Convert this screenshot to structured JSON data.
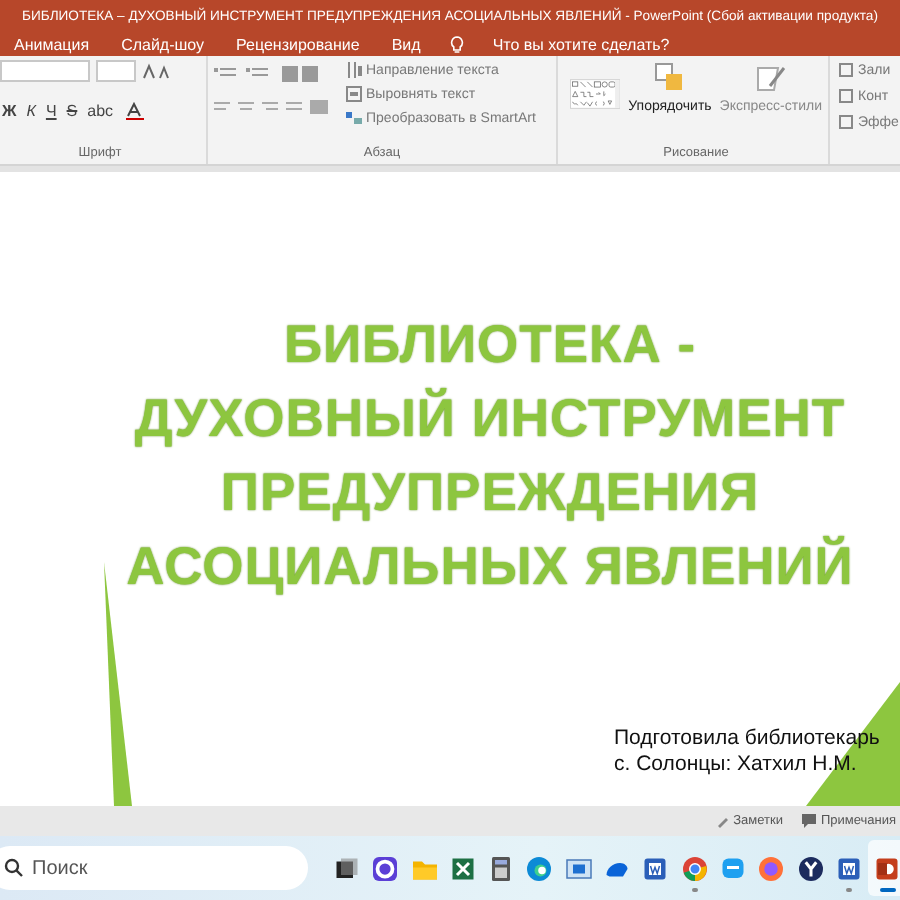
{
  "window": {
    "title": "БИБЛИОТЕКА – ДУХОВНЫЙ ИНСТРУМЕНТ ПРЕДУПРЕЖДЕНИЯ АСОЦИАЛЬНЫХ ЯВЛЕНИЙ - PowerPoint (Сбой активации продукта)"
  },
  "tabs": [
    {
      "label": "Анимация",
      "selected": false
    },
    {
      "label": "Слайд-шоу",
      "selected": false
    },
    {
      "label": "Рецензирование",
      "selected": false
    },
    {
      "label": "Вид",
      "selected": false
    }
  ],
  "tell_me": {
    "placeholder": "Что вы хотите сделать?"
  },
  "ribbon": {
    "font_buttons": [
      "Ж",
      "К",
      "Ч",
      "S",
      "abc"
    ],
    "paragraph_commands": [
      "Направление текста",
      "Выровнять текст",
      "Преобразовать в SmartArt"
    ],
    "arrange": "Упорядочить",
    "styles": "Экспресс-стили",
    "shape_commands": [
      "Зали",
      "Конт",
      "Эффе"
    ],
    "groups": [
      "Шрифт",
      "Абзац",
      "Рисование"
    ]
  },
  "slide": {
    "title_lines": [
      "БИБЛИОТЕКА -",
      "ДУХОВНЫЙ ИНСТРУМЕНТ",
      "ПРЕДУПРЕЖДЕНИЯ",
      "АСОЦИАЛЬНЫХ ЯВЛЕНИЙ"
    ],
    "subtitle_lines": [
      "Подготовила библиотекарь",
      "с. Солонцы: Хатхил Н.М."
    ]
  },
  "status_bar": {
    "items": [
      "Заметки",
      "Примечания"
    ]
  },
  "taskbar": {
    "search": {
      "placeholder": "Поиск"
    },
    "apps": [
      {
        "kind": "taskview",
        "running": false,
        "selected": false
      },
      {
        "kind": "ring",
        "running": false,
        "selected": false
      },
      {
        "kind": "folder",
        "running": false,
        "selected": false
      },
      {
        "kind": "sheet",
        "running": false,
        "selected": false
      },
      {
        "kind": "calculator",
        "running": false,
        "selected": false
      },
      {
        "kind": "browser",
        "running": false,
        "selected": false
      },
      {
        "kind": "window",
        "running": false,
        "selected": false
      },
      {
        "kind": "cloud",
        "running": false,
        "selected": false
      },
      {
        "kind": "doc",
        "running": false,
        "selected": false
      },
      {
        "kind": "chrome",
        "running": true,
        "selected": false
      },
      {
        "kind": "chat",
        "running": false,
        "selected": false
      },
      {
        "kind": "fox",
        "running": false,
        "selected": false
      },
      {
        "kind": "y",
        "running": false,
        "selected": false
      },
      {
        "kind": "doc",
        "running": true,
        "selected": false
      },
      {
        "kind": "slides",
        "running": true,
        "selected": true
      }
    ]
  }
}
